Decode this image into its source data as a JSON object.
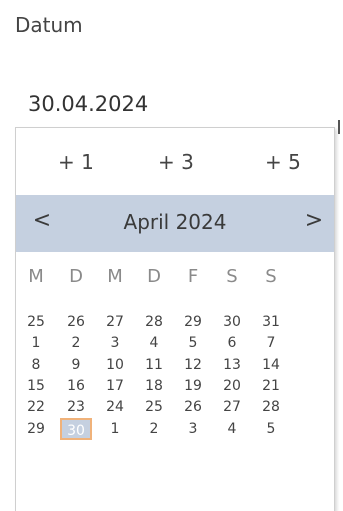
{
  "field": {
    "label": "Datum",
    "value": "30.04.2024"
  },
  "quick_buttons": [
    "+ 1",
    "+ 3",
    "+ 5"
  ],
  "calendar": {
    "month_title": "April 2024",
    "prev_icon": "chevron-left",
    "next_icon": "chevron-right",
    "prev_glyph": "<",
    "next_glyph": ">",
    "weekdays": [
      "M",
      "D",
      "M",
      "D",
      "F",
      "S",
      "S"
    ],
    "weeks": [
      [
        "25",
        "26",
        "27",
        "28",
        "29",
        "30",
        "31"
      ],
      [
        "1",
        "2",
        "3",
        "4",
        "5",
        "6",
        "7"
      ],
      [
        "8",
        "9",
        "10",
        "11",
        "12",
        "13",
        "14"
      ],
      [
        "15",
        "16",
        "17",
        "18",
        "19",
        "20",
        "21"
      ],
      [
        "22",
        "23",
        "24",
        "25",
        "26",
        "27",
        "28"
      ],
      [
        "29",
        "30",
        "1",
        "2",
        "3",
        "4",
        "5"
      ]
    ],
    "selected_day": "30",
    "colors": {
      "header_bg": "#c5d0e0",
      "selected_bg": "#c5d0e0",
      "selected_border": "#f0b27a"
    }
  }
}
